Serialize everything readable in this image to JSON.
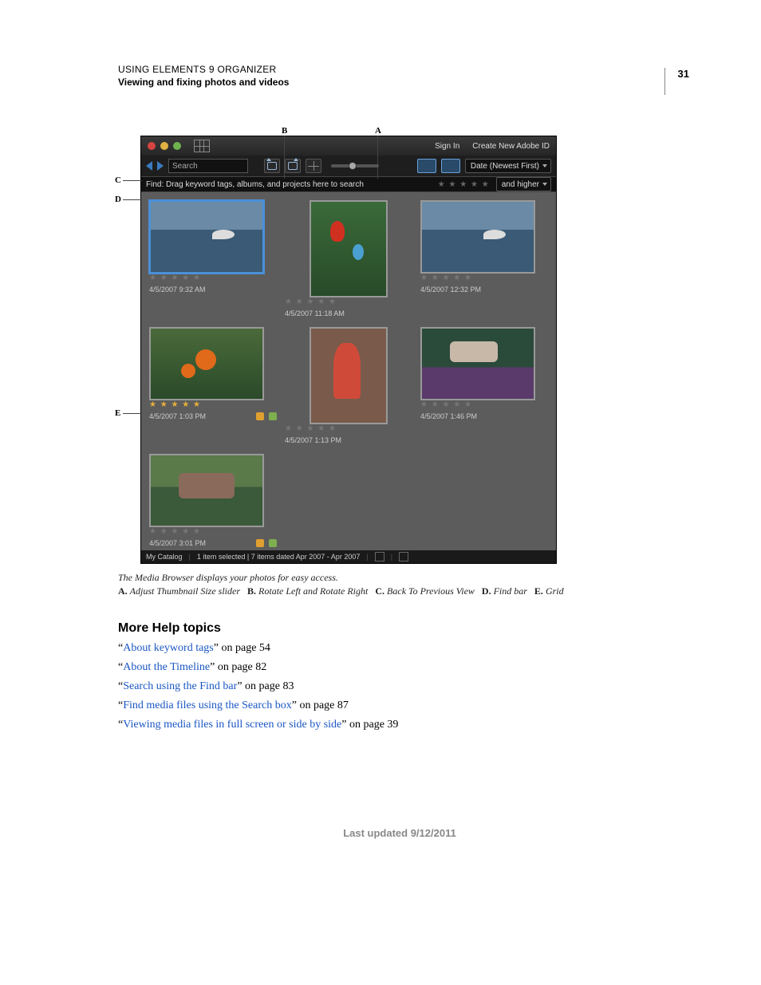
{
  "header": {
    "title": "USING ELEMENTS 9 ORGANIZER",
    "subtitle": "Viewing and fixing photos and videos",
    "page_number": "31"
  },
  "callouts": {
    "A": "A",
    "B": "B",
    "C": "C",
    "D": "D",
    "E": "E"
  },
  "ui": {
    "titlebar": {
      "sign_in": "Sign In",
      "create_id": "Create New Adobe ID"
    },
    "toolbar": {
      "search_placeholder": "Search",
      "sort_dropdown": "Date (Newest First)"
    },
    "findbar": {
      "hint": "Find: Drag keyword tags, albums, and projects here to search",
      "filter_dropdown": "and higher"
    },
    "thumbs": [
      {
        "date": "4/5/2007 9:32 AM",
        "rated": false,
        "orient": "h",
        "scene": "sc-dolphin",
        "selected": true,
        "badges": false
      },
      {
        "date": "4/5/2007 11:18 AM",
        "rated": false,
        "orient": "v",
        "scene": "sc-parrot",
        "selected": false,
        "badges": false
      },
      {
        "date": "4/5/2007 12:32 PM",
        "rated": false,
        "orient": "h",
        "scene": "sc-dolphin",
        "selected": false,
        "badges": false
      },
      {
        "date": "4/5/2007 1:03 PM",
        "rated": true,
        "orient": "h",
        "scene": "sc-flowers",
        "selected": false,
        "badges": true
      },
      {
        "date": "4/5/2007 1:13 PM",
        "rated": false,
        "orient": "v",
        "scene": "sc-kids",
        "selected": false,
        "badges": false
      },
      {
        "date": "4/5/2007 1:46 PM",
        "rated": false,
        "orient": "h",
        "scene": "sc-car",
        "selected": false,
        "badges": false
      },
      {
        "date": "4/5/2007 3:01 PM",
        "rated": false,
        "orient": "h",
        "scene": "sc-family",
        "selected": false,
        "badges": true
      }
    ],
    "statusbar": {
      "catalog": "My Catalog",
      "summary": "1 item selected | 7 items dated Apr 2007 - Apr 2007"
    }
  },
  "caption": {
    "main": "The Media Browser displays your photos for easy access.",
    "legend": [
      {
        "key": "A.",
        "text": "Adjust Thumbnail Size slider"
      },
      {
        "key": "B.",
        "text": "Rotate Left and Rotate Right"
      },
      {
        "key": "C.",
        "text": "Back To Previous View"
      },
      {
        "key": "D.",
        "text": "Find bar"
      },
      {
        "key": "E.",
        "text": "Grid"
      }
    ]
  },
  "help": {
    "heading": "More Help topics",
    "items": [
      {
        "link": "About keyword tags",
        "suffix": " on page 54"
      },
      {
        "link": "About the Timeline",
        "suffix": " on page 82"
      },
      {
        "link": "Search using the Find bar",
        "suffix": " on page 83"
      },
      {
        "link": "Find media files using the Search box",
        "suffix": " on page 87"
      },
      {
        "link": "Viewing media files in full screen or side by side",
        "suffix": " on page 39"
      }
    ]
  },
  "footer": "Last updated 9/12/2011"
}
